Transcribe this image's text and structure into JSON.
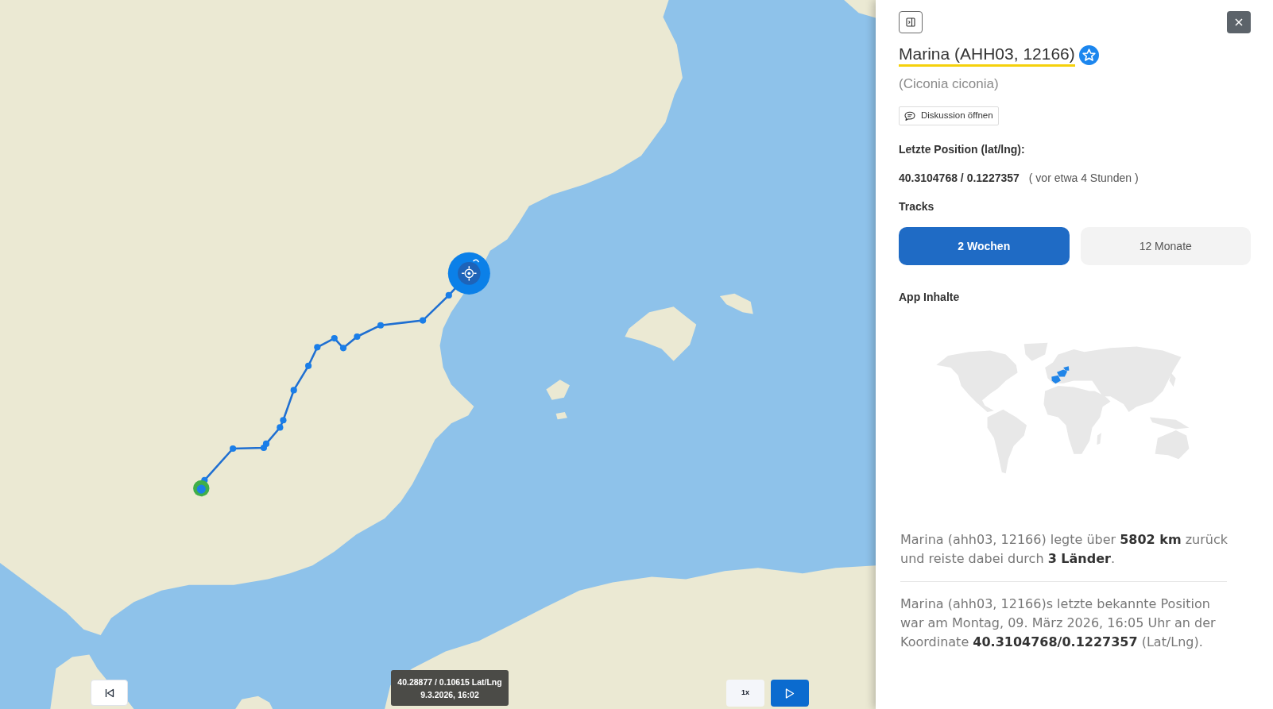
{
  "map": {
    "tooltip": {
      "coordinates": "40.28877 / 0.10615 Lat/Lng",
      "time": "9.3.2026, 16:02"
    },
    "speed_button": {
      "label": "1x"
    }
  },
  "panel": {
    "title": "Marina (AHH03, 12166)",
    "subtitle": "(Ciconia ciconia)",
    "discussion_button": {
      "label": "Diskussion öffnen"
    },
    "last_position": {
      "label": "Letzte Position (lat/lng):",
      "value": "40.3104768 / 0.1227357",
      "relative_time": "( vor etwa 4 Stunden )"
    },
    "tracks": {
      "label": "Tracks",
      "options": [
        {
          "label": "2 Wochen",
          "selected": true
        },
        {
          "label": "12 Monate",
          "selected": false
        }
      ]
    },
    "app_content": {
      "heading": "App Inhalte",
      "paragraphs": [
        "Marina (ahh03, 12166) legte über **5802 km** zurück und reiste dabei durch **3 Länder**.",
        "Marina (ahh03, 12166)s letzte bekannte Position war am Montag, 09. März 2026, 16:05 Uhr an der Koordinate **40.3104768/0.1227357** (Lat/Lng)."
      ]
    }
  }
}
